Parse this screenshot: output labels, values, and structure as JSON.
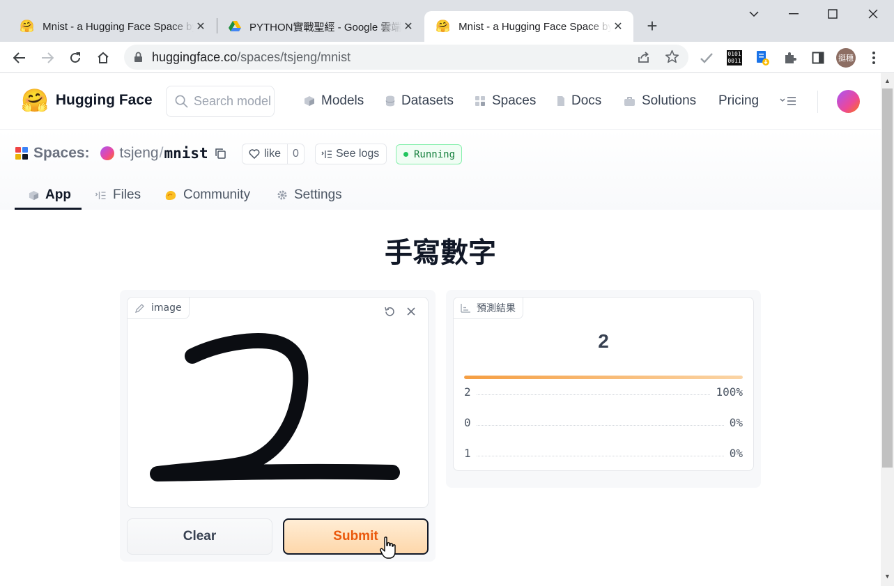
{
  "browser": {
    "tabs": [
      {
        "title": "Mnist - a Hugging Face Space by tsjeng",
        "close": "✕"
      },
      {
        "title": "PYTHON實戰聖經 - Google 雲端硬碟",
        "close": "✕"
      },
      {
        "title": "Mnist - a Hugging Face Space by tsjeng",
        "close": "✕"
      }
    ],
    "new_tab": "+",
    "url_host": "huggingface.co",
    "url_path": "/spaces/tsjeng/mnist",
    "profile_label": "挺穗"
  },
  "hf": {
    "brand": "Hugging Face",
    "search_placeholder": "Search models, datasets, users...",
    "nav": [
      "Models",
      "Datasets",
      "Spaces",
      "Docs",
      "Solutions",
      "Pricing"
    ]
  },
  "space": {
    "section": "Spaces:",
    "owner": "tsjeng",
    "separator": "/",
    "repo": "mnist",
    "like_label": "like",
    "like_count": "0",
    "logs_label": "See logs",
    "status": "Running",
    "tabs": [
      "App",
      "Files",
      "Community",
      "Settings"
    ]
  },
  "app": {
    "title": "手寫數字",
    "input_label": "image",
    "output_label": "預測結果",
    "prediction": "2",
    "confidences": [
      {
        "label": "2",
        "value": "100%"
      },
      {
        "label": "0",
        "value": "0%"
      },
      {
        "label": "1",
        "value": "0%"
      }
    ],
    "top_confidence_fraction": 1.0,
    "clear_label": "Clear",
    "submit_label": "Submit"
  },
  "colors": {
    "accent": "#ea580c",
    "status_green": "#15803d"
  }
}
